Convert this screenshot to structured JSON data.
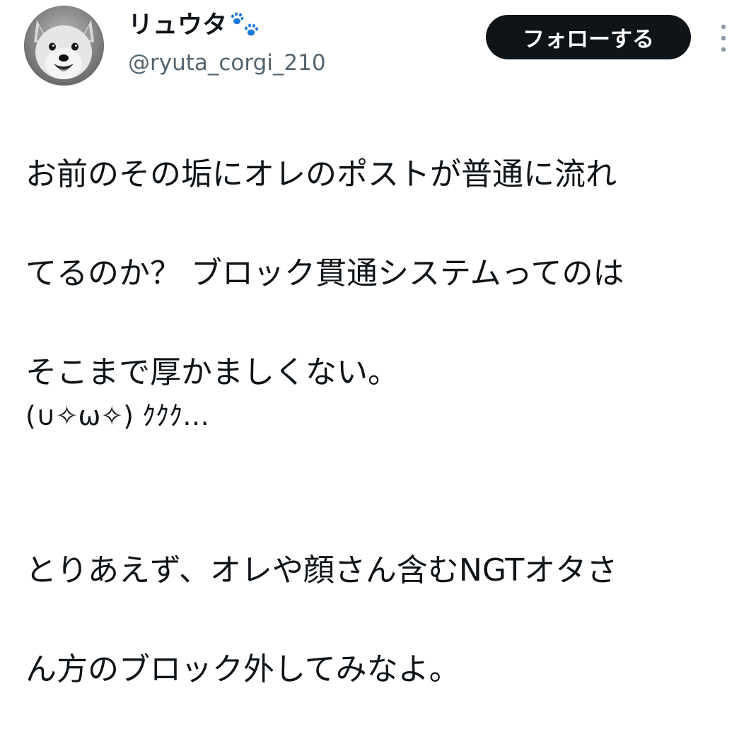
{
  "author": {
    "display_name": "リュウタ",
    "handle": "@ryuta_corgi_210",
    "avatar_icon": "corgi-avatar-icon",
    "name_emoji_icon": "paw-prints-icon",
    "name_emoji_color": "#1d7bd8"
  },
  "actions": {
    "follow_label": "フォローする",
    "more_icon": "more-vertical-icon"
  },
  "tweet": {
    "lines": [
      "お前のその垢にオレのポストが普通に流れ",
      "てるのか？ ブロック貫通システムってのは",
      "そこまで厚かましくない。",
      "",
      "とりあえず、オレや顔さん含むNGTオタさ",
      "ん方のブロック外してみなよ。"
    ],
    "emoticon": "(∪✧ω✧) ｸｸｸ…"
  },
  "colors": {
    "text": "#0f1419",
    "secondary_text": "#536471",
    "button_bg": "#0f1419",
    "button_text": "#ffffff"
  }
}
